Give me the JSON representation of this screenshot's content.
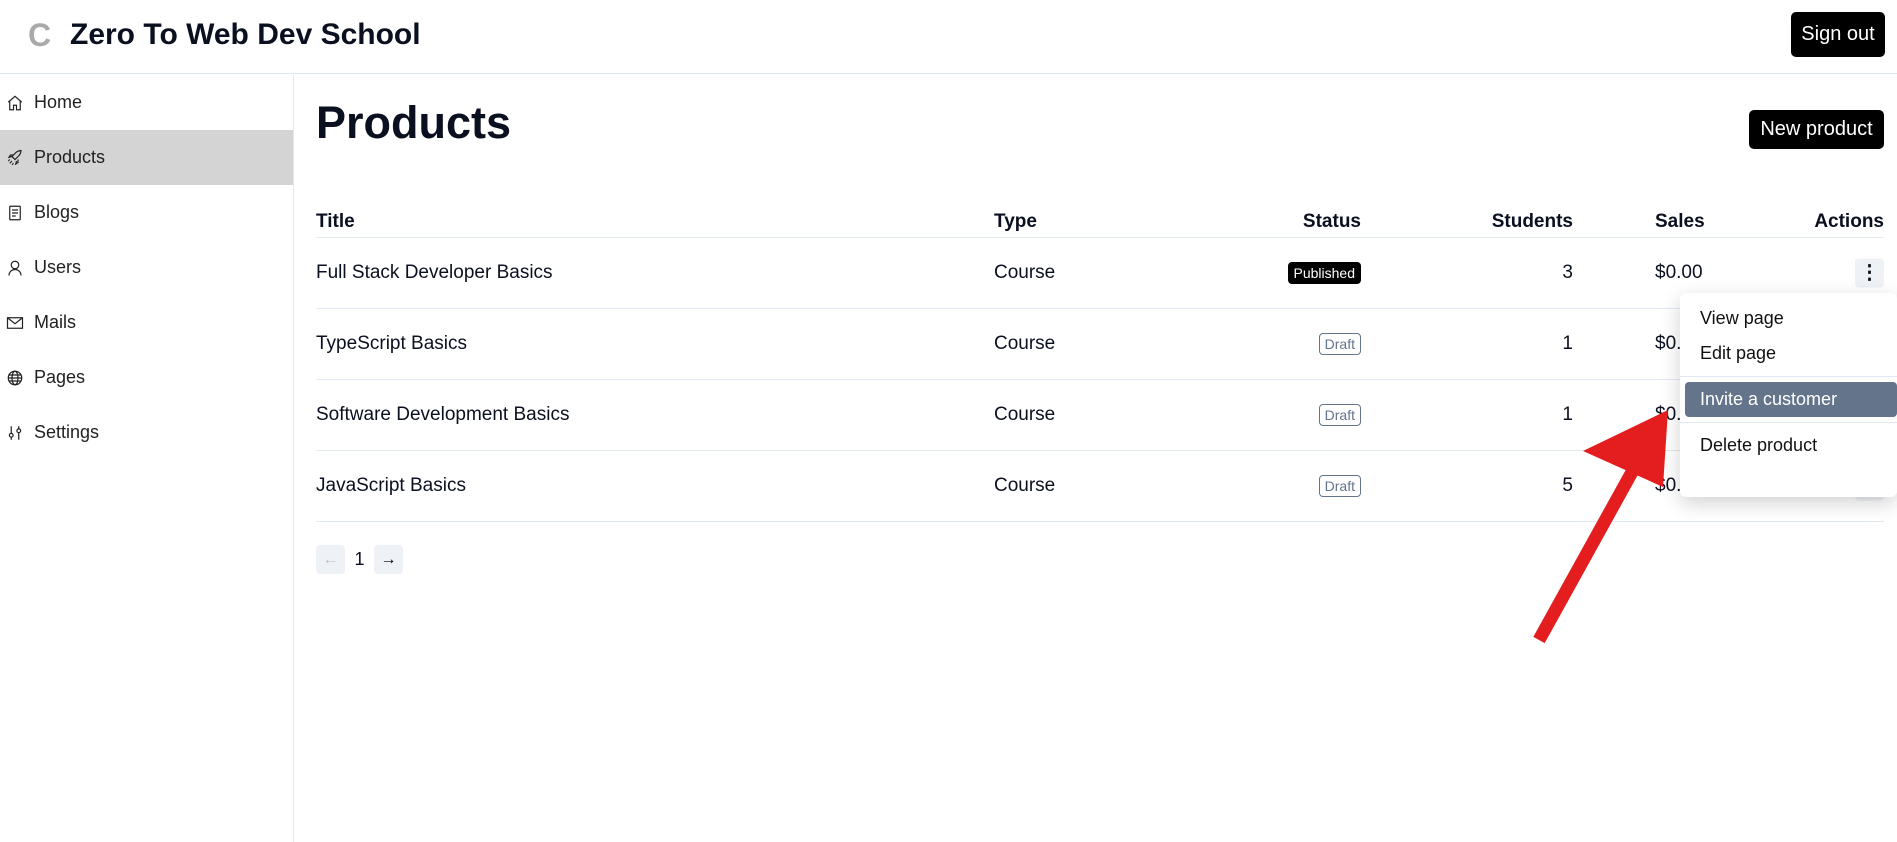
{
  "header": {
    "brand": "Zero To Web Dev School",
    "sign_out": "Sign out"
  },
  "sidebar": {
    "items": [
      {
        "label": "Home",
        "icon": "home-icon"
      },
      {
        "label": "Products",
        "icon": "rocket-icon",
        "active": true
      },
      {
        "label": "Blogs",
        "icon": "document-icon"
      },
      {
        "label": "Users",
        "icon": "user-icon"
      },
      {
        "label": "Mails",
        "icon": "mail-icon"
      },
      {
        "label": "Pages",
        "icon": "globe-icon"
      },
      {
        "label": "Settings",
        "icon": "sliders-icon"
      }
    ]
  },
  "main": {
    "title": "Products",
    "new_product": "New product",
    "columns": [
      "Title",
      "Type",
      "Status",
      "Students",
      "Sales",
      "Actions"
    ],
    "rows": [
      {
        "title": "Full Stack Developer Basics",
        "type": "Course",
        "status": "Published",
        "students": "3",
        "sales": "$0.00"
      },
      {
        "title": "TypeScript Basics",
        "type": "Course",
        "status": "Draft",
        "students": "1",
        "sales": "$0.00"
      },
      {
        "title": "Software Development Basics",
        "type": "Course",
        "status": "Draft",
        "students": "1",
        "sales": "$0.00"
      },
      {
        "title": "JavaScript Basics",
        "type": "Course",
        "status": "Draft",
        "students": "5",
        "sales": "$0.00"
      }
    ],
    "pagination": {
      "current": "1",
      "prev": "←",
      "next": "→"
    }
  },
  "menu": {
    "items": [
      "View page",
      "Edit page",
      "Invite a customer",
      "Delete product"
    ],
    "highlighted": "Invite a customer"
  },
  "colors": {
    "accent": "#000000",
    "menu_highlight": "#64748b",
    "annotation_arrow": "#e41e1e"
  }
}
